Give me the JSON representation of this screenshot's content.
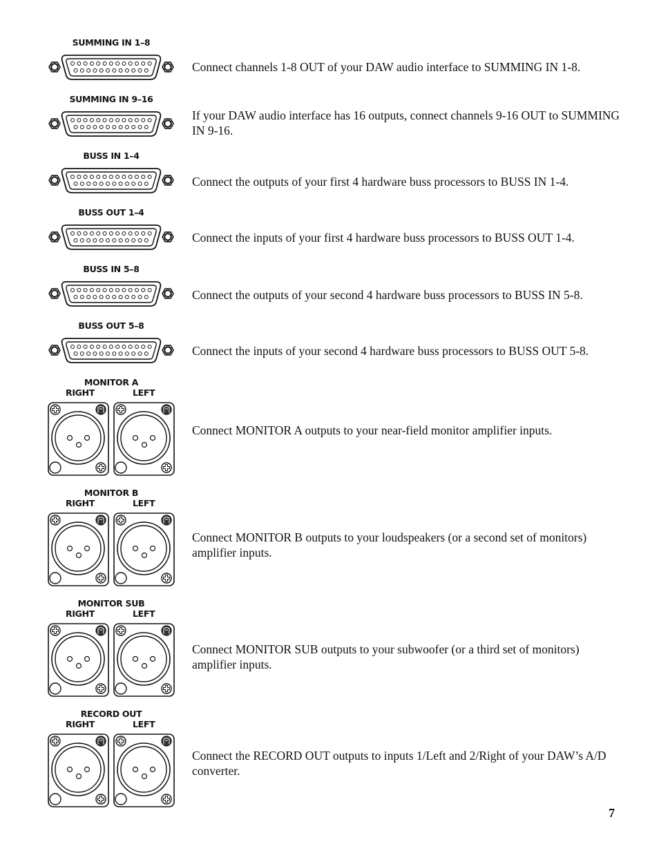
{
  "page_number": "7",
  "dsub_sections": [
    {
      "label": "SUMMING IN 1–8",
      "description": "Connect channels 1-8 OUT of your DAW audio interface to SUMMING IN 1-8."
    },
    {
      "label": "SUMMING IN 9–16",
      "description": "If your DAW audio interface has 16 outputs, connect channels 9-16 OUT to SUMMING IN 9-16."
    },
    {
      "label": "BUSS IN 1–4",
      "description": "Connect the outputs of your first 4 hardware buss processors to BUSS IN 1-4."
    },
    {
      "label": "BUSS OUT 1–4",
      "description": "Connect the inputs of your first 4 hardware buss processors to BUSS OUT 1-4."
    },
    {
      "label": "BUSS IN 5–8",
      "description": "Connect the outputs of your second 4 hardware buss processors to BUSS IN 5-8."
    },
    {
      "label": "BUSS OUT 5–8",
      "description": "Connect the inputs of your second 4 hardware buss processors to BUSS OUT 5-8."
    }
  ],
  "xlr_sections": [
    {
      "label": "MONITOR A",
      "right": "RIGHT",
      "left": "LEFT",
      "description": "Connect MONITOR A outputs to your near-field monitor amplifier inputs."
    },
    {
      "label": "MONITOR B",
      "right": "RIGHT",
      "left": "LEFT",
      "description": "Connect MONITOR B outputs to your loudspeakers (or a second set of monitors) amplifier inputs."
    },
    {
      "label": "MONITOR SUB",
      "right": "RIGHT",
      "left": "LEFT",
      "description": "Connect MONITOR SUB outputs to your subwoofer (or a third set of monitors) amplifier inputs."
    },
    {
      "label": "RECORD OUT",
      "right": "RIGHT",
      "left": "LEFT",
      "description": "Connect the RECORD OUT outputs to inputs 1/Left and 2/Right of your DAW’s A/D converter."
    }
  ],
  "icons": {
    "dsub": "db25-connector-icon",
    "xlr": "xlr-connector-icon"
  }
}
